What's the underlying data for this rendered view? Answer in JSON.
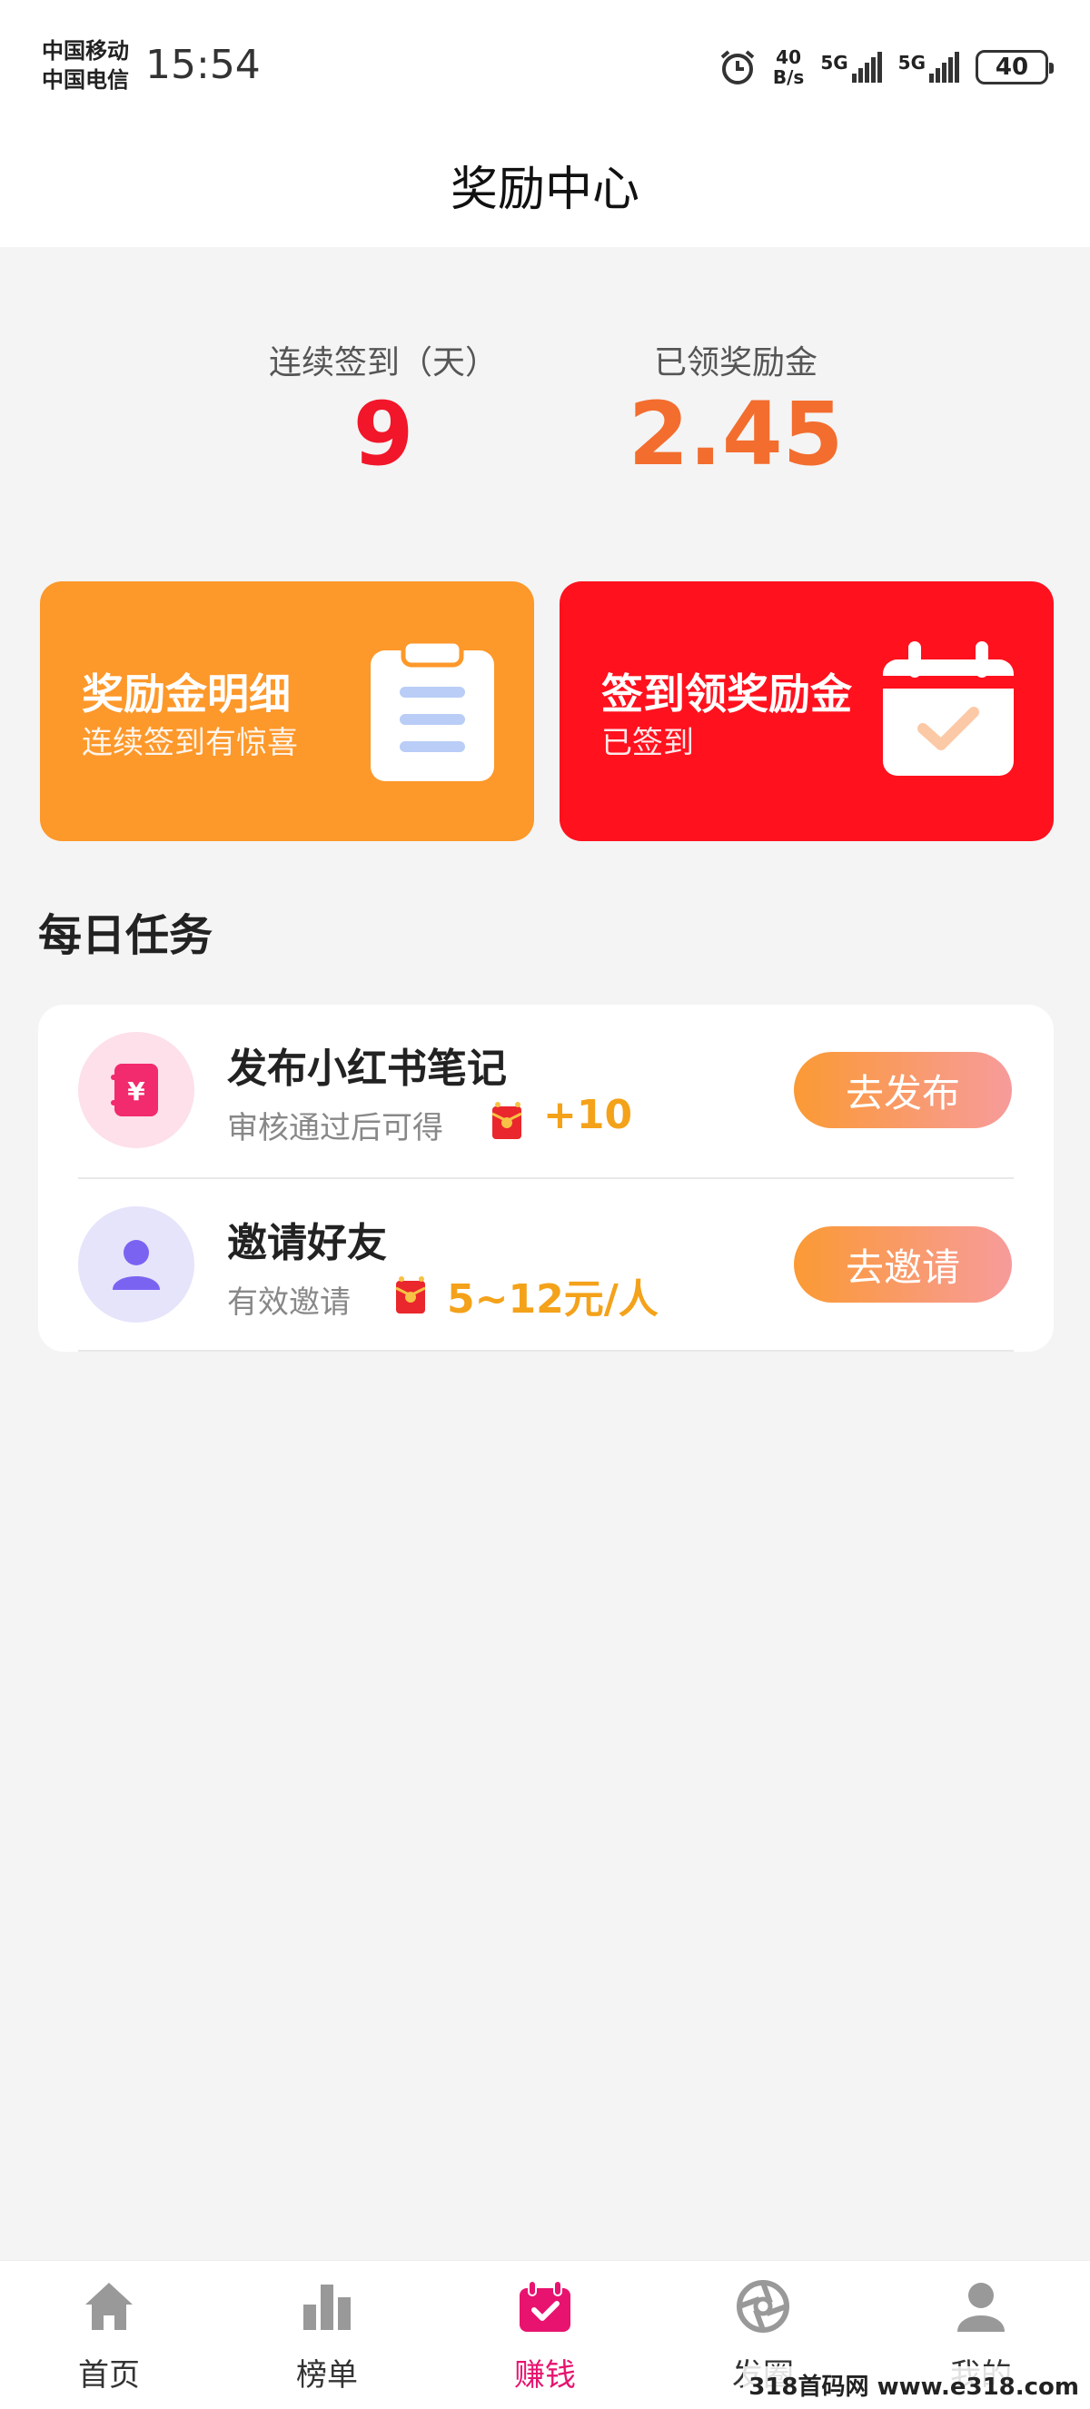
{
  "status_bar": {
    "carrier_1": "中国移动",
    "carrier_2": "中国电信",
    "time": "15:54",
    "net_speed_value": "40",
    "net_speed_unit": "B/s",
    "signal_1_label": "5G",
    "signal_2_label": "5G",
    "battery": "40"
  },
  "header": {
    "title": "奖励中心"
  },
  "stats": {
    "days_label": "连续签到（天）",
    "days_value": "9",
    "reward_label": "已领奖励金",
    "reward_value": "2.45"
  },
  "cards": [
    {
      "title": "奖励金明细",
      "subtitle": "连续签到有惊喜",
      "color": "#fd982a",
      "icon": "clipboard-icon"
    },
    {
      "title": "签到领奖励金",
      "subtitle": "已签到",
      "color": "#ff111e",
      "icon": "calendar-check-icon"
    }
  ],
  "daily_tasks": {
    "title": "每日任务",
    "items": [
      {
        "name": "发布小红书笔记",
        "desc": "审核通过后可得",
        "reward": "+10",
        "button": "去发布",
        "icon": "note-icon"
      },
      {
        "name": "邀请好友",
        "desc": "有效邀请",
        "reward": "5~12元/人",
        "button": "去邀请",
        "icon": "user-icon"
      }
    ]
  },
  "bottom_nav": {
    "active_color": "#e8136f",
    "items": [
      {
        "label": "首页",
        "icon": "home-icon"
      },
      {
        "label": "榜单",
        "icon": "chart-icon"
      },
      {
        "label": "赚钱",
        "icon": "earn-icon",
        "active": true
      },
      {
        "label": "发圈",
        "icon": "aperture-icon"
      },
      {
        "label": "我的",
        "icon": "profile-icon"
      }
    ]
  },
  "watermark": "318首码网 www.e318.com"
}
